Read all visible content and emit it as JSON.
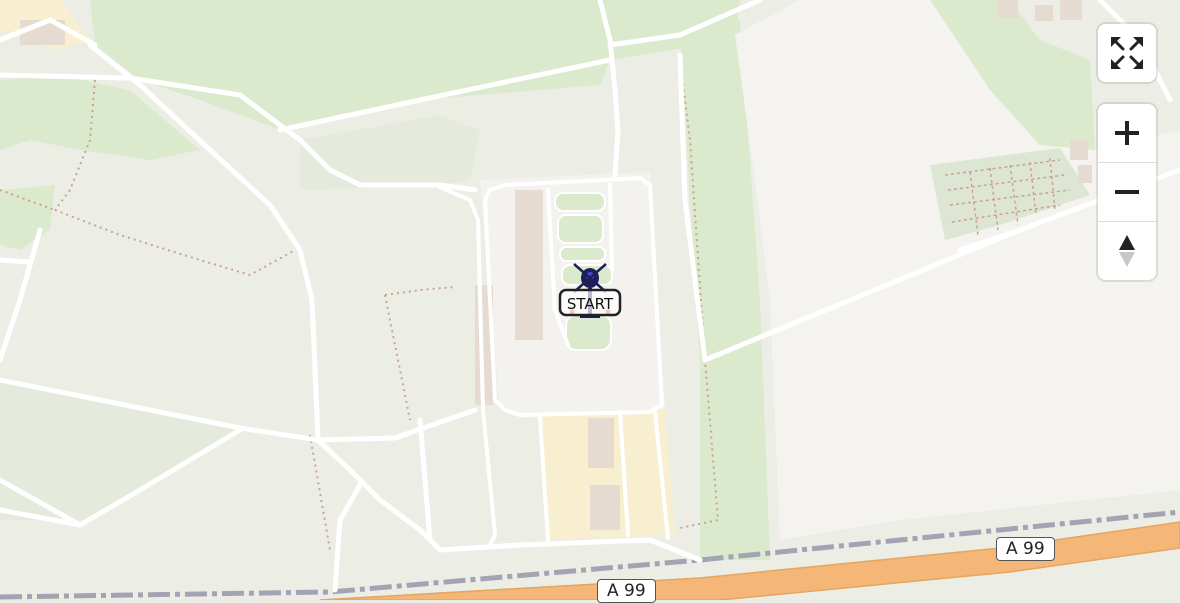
{
  "map": {
    "road_labels": [
      {
        "id": "a99-right",
        "text": "A 99"
      },
      {
        "id": "a99-left",
        "text": "A 99"
      }
    ],
    "start_marker": {
      "label": "START",
      "icon": "helicopter-icon"
    },
    "colors": {
      "background": "#eceee6",
      "forest": "#dbe9cd",
      "meadow": "#e4ebdc",
      "field": "#f5f3ef",
      "motorway": "#f4b778",
      "rail": "#a3a4b3",
      "road": "#ffffff",
      "building": "#e6dbd0",
      "industrial": "#f7efcf",
      "marker": "#1e1e5a"
    }
  },
  "controls": {
    "fullscreen_icon": "fullscreen-icon",
    "zoom_in_icon": "plus-icon",
    "zoom_out_icon": "minus-icon",
    "compass_icon": "compass-icon"
  }
}
